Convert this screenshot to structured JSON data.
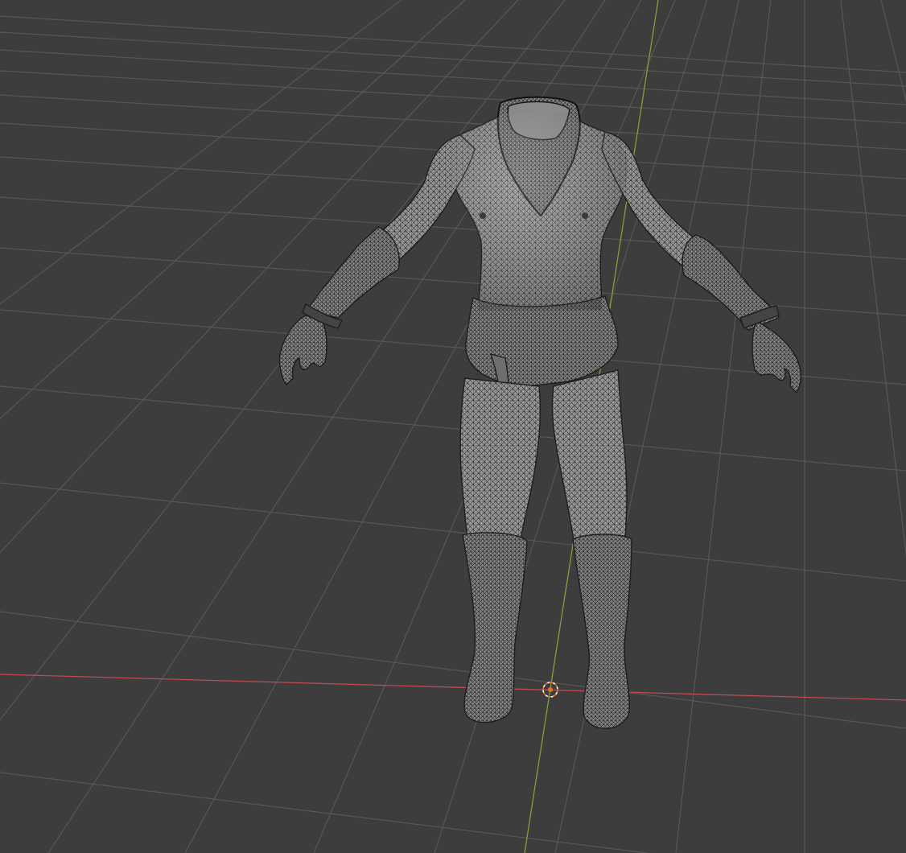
{
  "viewport": {
    "mode": "3d-viewport",
    "shading": "solid-wireframe",
    "background_color": "#3d3d3d",
    "grid_color": "#565656",
    "x_axis_color": "#c04a55",
    "y_axis_color": "#7ea23b",
    "mesh_fill_color": "#9a9a9a",
    "mesh_wire_color": "#2a2a2a",
    "cursor_color": "#e8702a"
  },
  "scene": {
    "object": "character-mesh",
    "object_parts": [
      "body",
      "necklace",
      "arm-wraps-left",
      "arm-wraps-right",
      "belt",
      "boots-left",
      "boots-right"
    ],
    "origin_marker": "3d-cursor"
  }
}
